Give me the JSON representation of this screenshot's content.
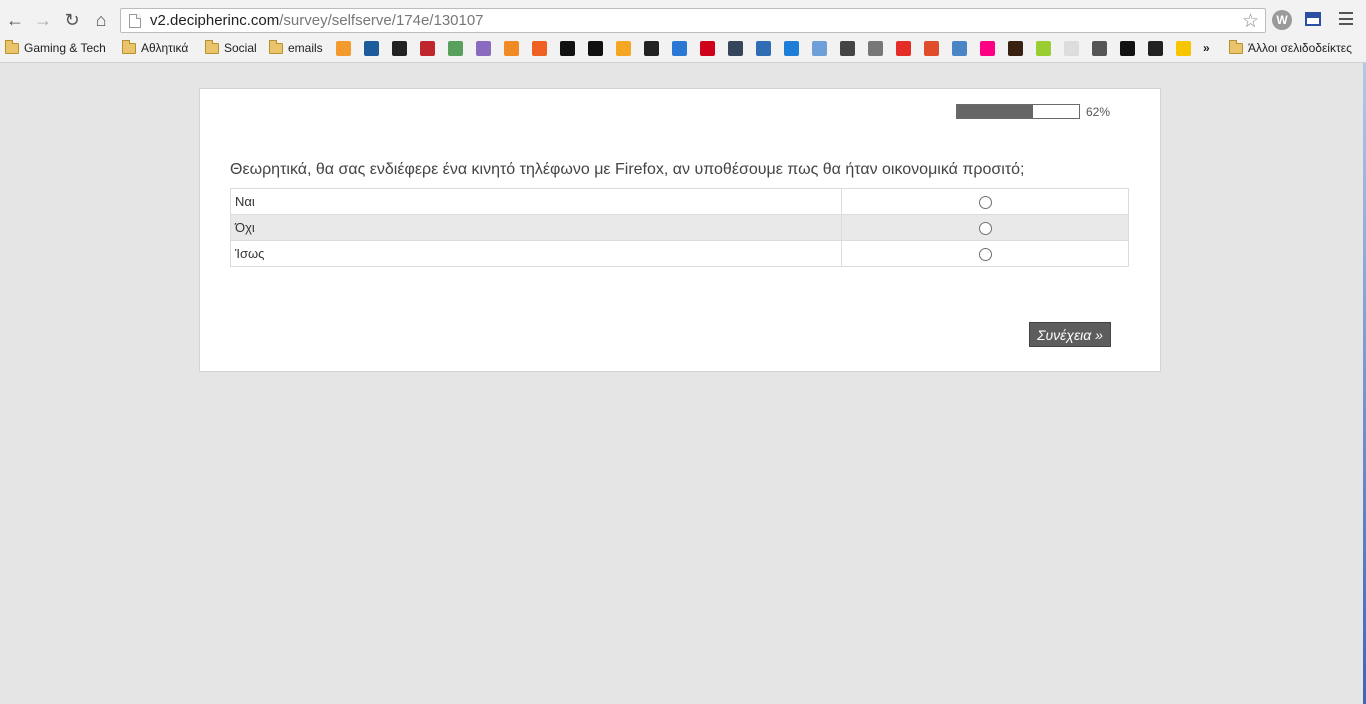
{
  "browser": {
    "url_host": "v2.decipherinc.com",
    "url_path": "/survey/selfserve/174e/130107",
    "icons": {
      "back": "arrow-left-icon",
      "forward": "arrow-right-icon",
      "reload": "reload-icon",
      "home": "home-icon",
      "star": "star-icon",
      "menu": "hamburger-menu-icon"
    },
    "extension_label": "W"
  },
  "bookmarks": {
    "folders": [
      {
        "label": "Gaming & Tech"
      },
      {
        "label": "Αθλητικά"
      },
      {
        "label": "Social"
      },
      {
        "label": "emails"
      }
    ],
    "overflow_label": "»",
    "other_label": "Άλλοι σελιδοδείκτες",
    "favicons": [
      {
        "name": "rss-icon",
        "color": "#f29a2e"
      },
      {
        "name": "pegi-icon",
        "color": "#1d5c9c"
      },
      {
        "name": "dark-logo-icon",
        "color": "#222222"
      },
      {
        "name": "red-circle-icon",
        "color": "#c0272d"
      },
      {
        "name": "green-logo-icon",
        "color": "#58a05b"
      },
      {
        "name": "purple-logo-icon",
        "color": "#8a6bbf"
      },
      {
        "name": "orange-logo-icon",
        "color": "#f08a24"
      },
      {
        "name": "bitly-icon",
        "color": "#ee6123"
      },
      {
        "name": "black-logo-icon",
        "color": "#111111"
      },
      {
        "name": "black-logo-2-icon",
        "color": "#111111"
      },
      {
        "name": "yellow-square-icon",
        "color": "#f5a623"
      },
      {
        "name": "black-logo-3-icon",
        "color": "#222222"
      },
      {
        "name": "blue-round-icon",
        "color": "#2a77d4"
      },
      {
        "name": "red-logo-icon",
        "color": "#d0021b"
      },
      {
        "name": "tumblr-icon",
        "color": "#35465c"
      },
      {
        "name": "fc-icon",
        "color": "#2f6db5"
      },
      {
        "name": "blue-13-icon",
        "color": "#1c7ed6"
      },
      {
        "name": "doc-icon",
        "color": "#6f9fd8"
      },
      {
        "name": "goodreads-icon",
        "color": "#444444"
      },
      {
        "name": "wikipedia-icon",
        "color": "#777777"
      },
      {
        "name": "youtube-icon",
        "color": "#e52d27"
      },
      {
        "name": "wr-icon",
        "color": "#e04d2b"
      },
      {
        "name": "screen-icon",
        "color": "#4a86c5"
      },
      {
        "name": "flickr-icon",
        "color": "#ff0084"
      },
      {
        "name": "goodreads-dark-icon",
        "color": "#382110"
      },
      {
        "name": "green-stripes-icon",
        "color": "#9acd32"
      },
      {
        "name": "blank-page-icon",
        "color": "#dddddd"
      },
      {
        "name": "grey-logo-icon",
        "color": "#555555"
      },
      {
        "name": "black-c-icon",
        "color": "#111111"
      },
      {
        "name": "wave-icon",
        "color": "#222222"
      },
      {
        "name": "sun-icon",
        "color": "#f7c600"
      }
    ]
  },
  "survey": {
    "progress": {
      "percent": 62,
      "label": "62%"
    },
    "question": "Θεωρητικά, θα σας ενδιέφερε ένα κινητό τηλέφωνο με Firefox, αν υποθέσουμε πως θα ήταν οικονομικά προσιτό;",
    "options": [
      {
        "label": "Ναι"
      },
      {
        "label": "Όχι"
      },
      {
        "label": "Ίσως"
      }
    ],
    "next_label": "Συνέχεια »"
  }
}
